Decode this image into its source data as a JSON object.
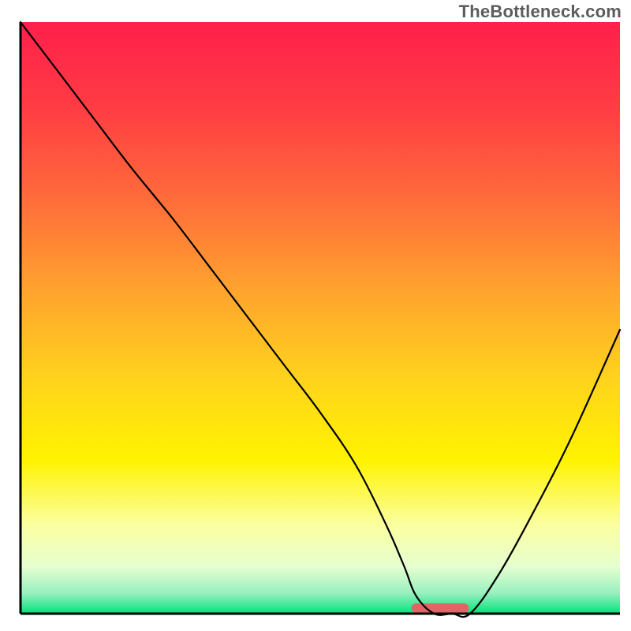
{
  "watermark": "TheBottleneck.com",
  "chart_data": {
    "type": "line",
    "title": "",
    "xlabel": "",
    "ylabel": "",
    "xlim": [
      0,
      100
    ],
    "ylim": [
      0,
      100
    ],
    "legend": false,
    "annotations": [],
    "background": {
      "type": "vertical-gradient",
      "stops": [
        {
          "pos": 0.0,
          "color": "#ff1f4b"
        },
        {
          "pos": 0.14,
          "color": "#ff3b44"
        },
        {
          "pos": 0.3,
          "color": "#ff6c3a"
        },
        {
          "pos": 0.45,
          "color": "#ffa22e"
        },
        {
          "pos": 0.6,
          "color": "#ffd21d"
        },
        {
          "pos": 0.74,
          "color": "#fff300"
        },
        {
          "pos": 0.85,
          "color": "#fbffa0"
        },
        {
          "pos": 0.92,
          "color": "#e6ffd0"
        },
        {
          "pos": 0.965,
          "color": "#9af0c0"
        },
        {
          "pos": 1.0,
          "color": "#00e37a"
        }
      ]
    },
    "series": [
      {
        "name": "bottleneck-curve",
        "color": "#000000",
        "width": 2.2,
        "x": [
          0,
          6,
          12,
          18,
          22,
          26,
          32,
          38,
          44,
          50,
          56,
          61,
          64,
          66,
          69,
          72,
          75,
          80,
          86,
          92,
          100
        ],
        "y": [
          100,
          92,
          84,
          76,
          71,
          66,
          58,
          50,
          42,
          34,
          25,
          15,
          8,
          3,
          0,
          0,
          0,
          7,
          18,
          30,
          48
        ]
      }
    ],
    "marker": {
      "name": "optimal-segment",
      "color": "#e06666",
      "x_start": 66,
      "x_end": 74,
      "y": 0,
      "thickness": 12,
      "cap": "round"
    },
    "frame": {
      "color": "#000000",
      "width": 3
    }
  }
}
